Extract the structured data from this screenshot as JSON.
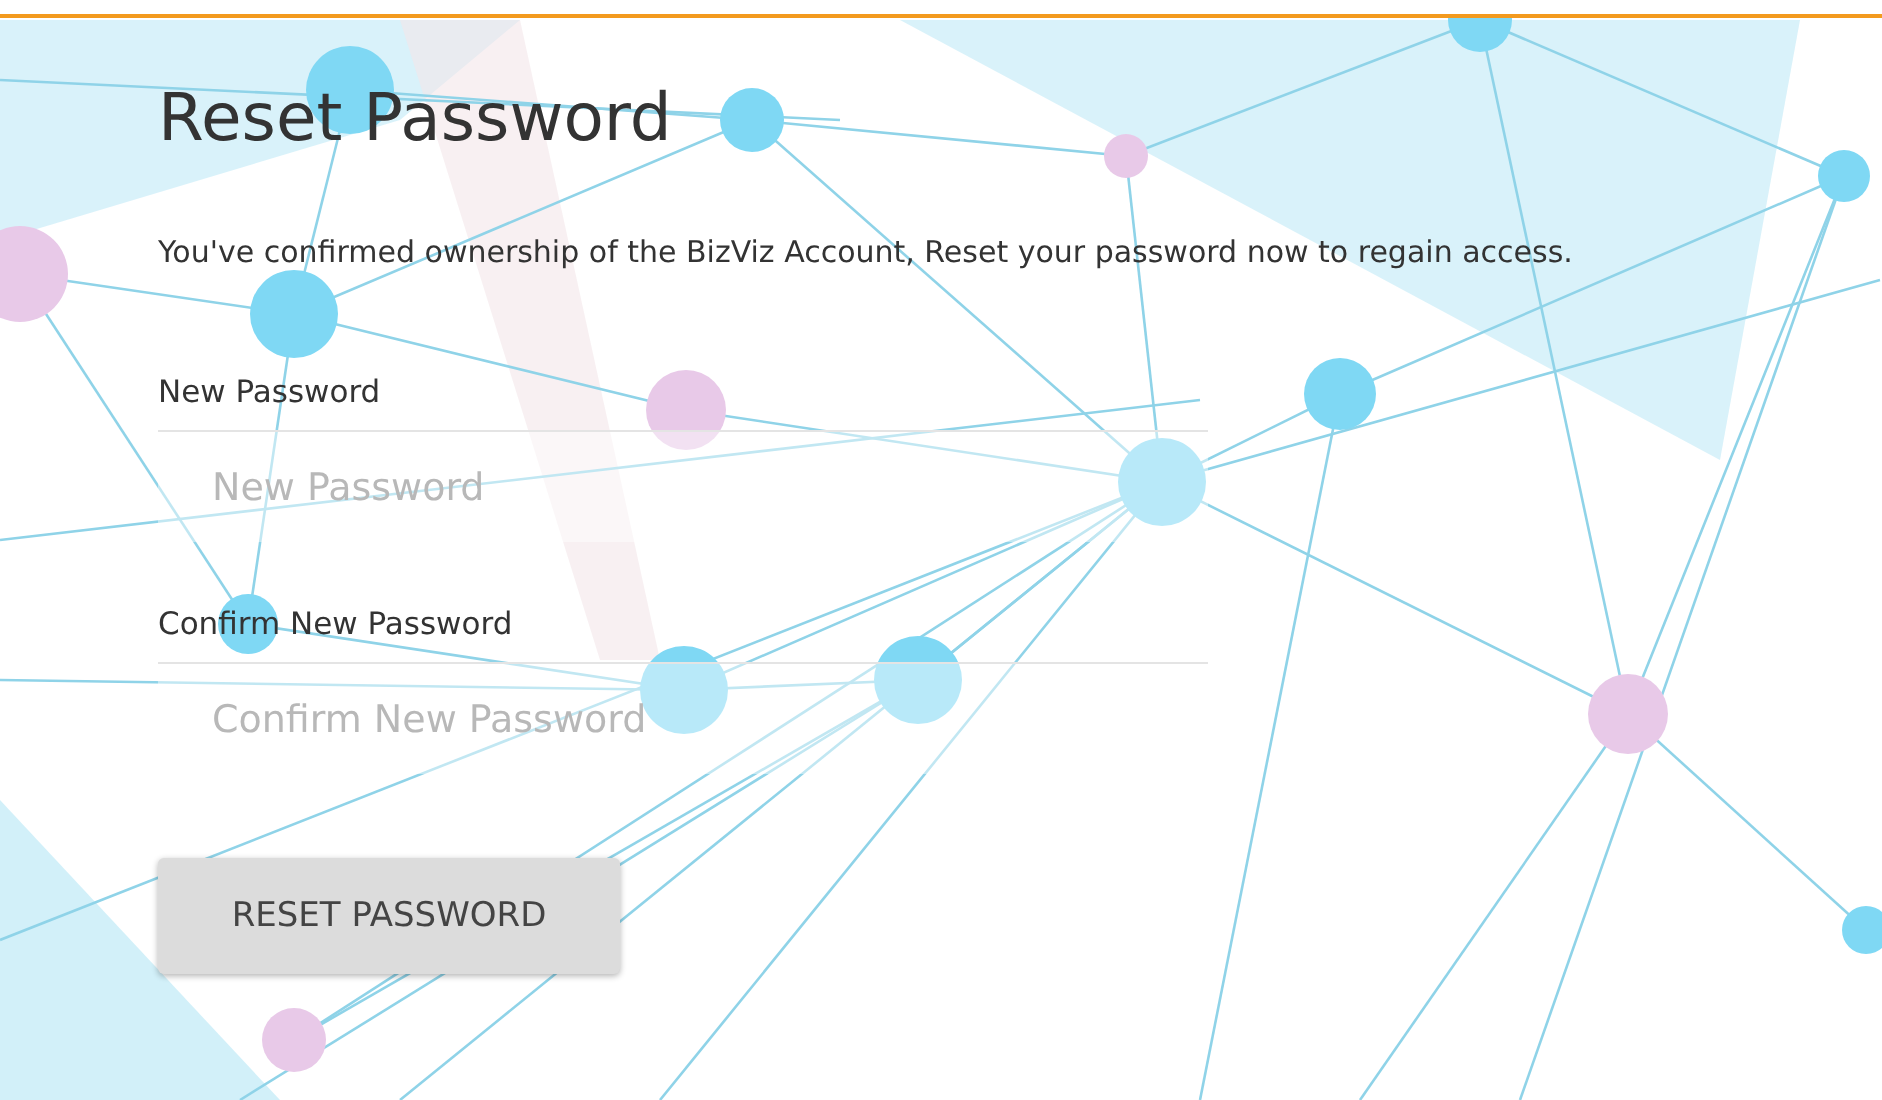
{
  "title": "Reset Password",
  "message": "You've confirmed ownership of the BizViz Account, Reset your password now to regain access.",
  "fields": [
    {
      "label": "New Password",
      "placeholder": "New Password"
    },
    {
      "label": "Confirm New Password",
      "placeholder": "Confirm New Password"
    }
  ],
  "button": "RESET PASSWORD"
}
